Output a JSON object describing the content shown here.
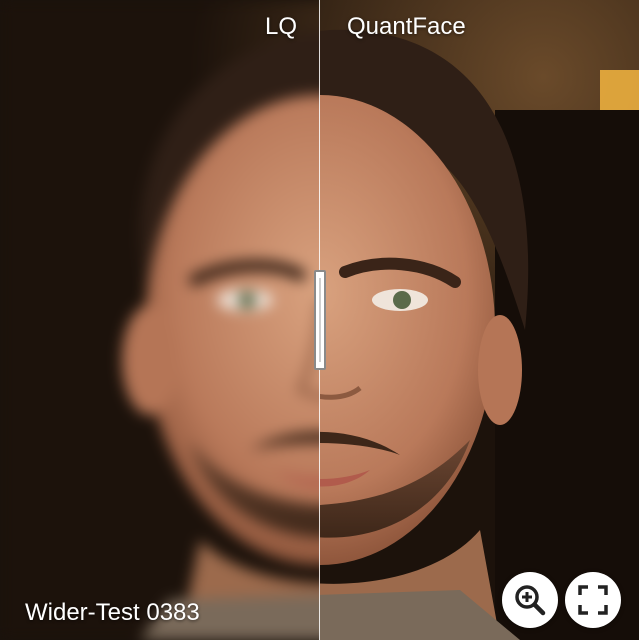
{
  "labels": {
    "left": "LQ",
    "right": "QuantFace"
  },
  "caption": "Wider-Test 0383",
  "controls": {
    "zoom_icon": "zoom-in-icon",
    "fullscreen_icon": "fullscreen-icon"
  },
  "slider": {
    "position_fraction": 0.5
  },
  "colors": {
    "label_text": "#ffffff",
    "control_bg": "#ffffff",
    "control_icon": "#222222",
    "divider": "#ffffff"
  }
}
